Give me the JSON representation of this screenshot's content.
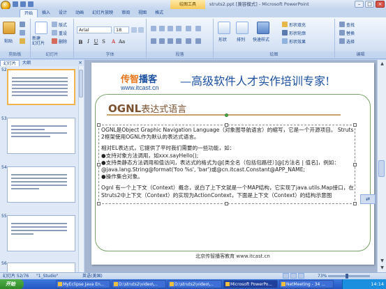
{
  "window": {
    "title": "struts2.ppt [兼容模式] - Microsoft PowerPoint",
    "context_tab": "绘图工具"
  },
  "ribbon": {
    "tabs": [
      "开始",
      "插入",
      "设计",
      "动画",
      "幻灯片放映",
      "审阅",
      "视图",
      "格式"
    ],
    "clipboard": {
      "paste": "粘贴",
      "label": "剪贴板"
    },
    "slides": {
      "new_slide": "新建\n幻灯片",
      "layout": "版式",
      "reset": "重设",
      "delete": "删除",
      "label": "幻灯片"
    },
    "font": {
      "name": "Arial",
      "size": "18",
      "label": "字体"
    },
    "paragraph": {
      "label": "段落"
    },
    "drawing": {
      "shapes": "形状",
      "arrange": "排列",
      "quick_styles": "快速样式",
      "fill": "形状填充",
      "outline": "形状轮廓",
      "effects": "形状效果",
      "label": "绘图"
    },
    "editing": {
      "find": "查找",
      "replace": "替换",
      "select": "选择",
      "label": "编辑"
    }
  },
  "left_pane": {
    "tabs": [
      "幻灯片",
      "大纲"
    ],
    "slide_numbers": [
      "52",
      "53",
      "54",
      "55",
      "56"
    ]
  },
  "slide": {
    "brand_cn": "传智",
    "brand_cn2": "播客",
    "brand_url": "www.itcast.cn",
    "slogan": "—高级软件人才实作培训专家!",
    "title_en": "OGNL",
    "title_cn": "表达式语言",
    "lines": [
      "OGNL是Object Graphic Navigation Language（对象图导航语言）的缩写，它是一个开源项目。 Struts 2框架使用OGNL作为默认的表达式语言。",
      "",
      "相对EL表达式，它提供了平时我们需要的一些功能，如：",
      "●支持对象方法调用，如xxx.sayHello();",
      "●支持类静态方法调用和值访问，表达式的格式为@[类全名（包括包路径）]@[方法名 | 值名]，例如：@java.lang.String@format('foo %s', 'bar')或@cn.itcast.Constant@APP_NAME;",
      "●操作集合对象。",
      "",
      "Ognl 有一个上下文（Context）概念，说白了上下文就是一个MAP结构，它实现了java.utils.Map接口，在Struts2中上下文（Context）的实现为ActionContext，下面是上下文（Context）的结构示意图"
    ],
    "footer": "北京传智播客教育 www.itcast.cn"
  },
  "status": {
    "slide": "幻灯片 52/76",
    "theme": "\"1_Studio\"",
    "language": "英语(美国)",
    "zoom": "73%"
  },
  "taskbar": {
    "start": "开始",
    "tasks": [
      "MyEclipse Java En...",
      "D:\\struts2\\video\\...",
      "D:\\struts2\\video\\...",
      "Microsoft PowerPo...",
      "NetMeeting - 34 ..."
    ],
    "clock": "14:14"
  },
  "colors": {
    "brand_orange": "#e8761b",
    "brand_blue": "#1b4fa0",
    "title_brown": "#7b5130",
    "frame_green": "#7aa36a"
  }
}
